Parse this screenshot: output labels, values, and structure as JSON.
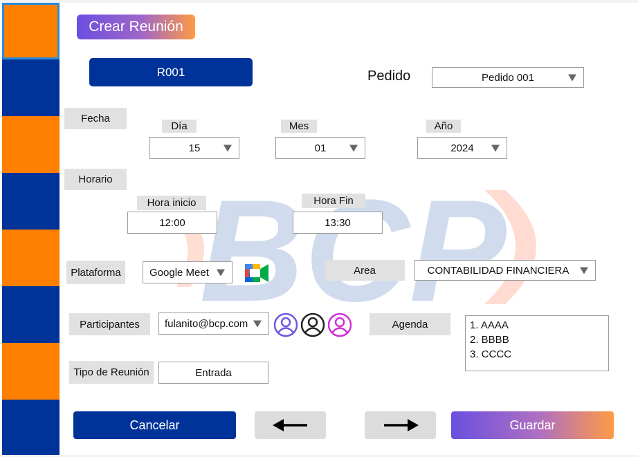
{
  "header": {
    "title": "Crear Reunión",
    "code": "R001"
  },
  "pedido": {
    "label": "Pedido",
    "value": "Pedido 001"
  },
  "fecha": {
    "label": "Fecha",
    "dia": {
      "label": "Día",
      "value": "15"
    },
    "mes": {
      "label": "Mes",
      "value": "01"
    },
    "anio": {
      "label": "Año",
      "value": "2024"
    }
  },
  "horario": {
    "label": "Horario",
    "inicio": {
      "label": "Hora inicio",
      "value": "12:00"
    },
    "fin": {
      "label": "Hora Fin",
      "value": "13:30"
    }
  },
  "plataforma": {
    "label": "Plataforma",
    "value": "Google Meet",
    "icon": "google-meet-icon"
  },
  "area": {
    "label": "Area",
    "value": "CONTABILIDAD FINANCIERA"
  },
  "participantes": {
    "label": "Participantes",
    "value": "fulanito@bcp.com"
  },
  "agenda": {
    "label": "Agenda",
    "items": [
      "1. AAAA",
      "2. BBBB",
      "3. CCCC"
    ]
  },
  "tipo": {
    "label": "Tipo de Reunión",
    "value": "Entrada"
  },
  "actions": {
    "cancel": "Cancelar",
    "save": "Guardar"
  },
  "watermark": "BCP",
  "colors": {
    "blue": "#003399",
    "orange": "#ff7f00",
    "gradient_start": "#6a4fe0",
    "gradient_end": "#ff9a44"
  }
}
